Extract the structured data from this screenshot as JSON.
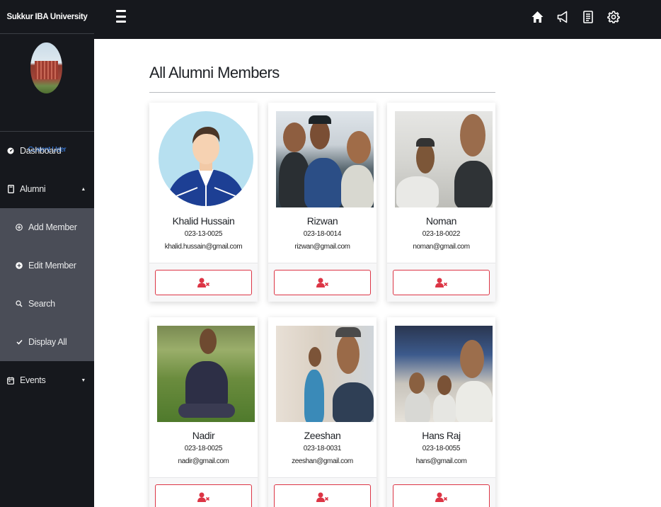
{
  "sidebar": {
    "brand": "Sukkur IBA University",
    "current_user": "Current User",
    "items": [
      {
        "label": "Dashboard",
        "icon": "dashboard-icon"
      },
      {
        "label": "Alumni",
        "icon": "alumni-icon"
      },
      {
        "label": "Add Member",
        "icon": "add-circle-icon"
      },
      {
        "label": "Edit Member",
        "icon": "edit-circle-icon"
      },
      {
        "label": "Search",
        "icon": "search-icon"
      },
      {
        "label": "Display All",
        "icon": "check-icon"
      },
      {
        "label": "Events",
        "icon": "calendar-icon"
      }
    ]
  },
  "topbar": {
    "icons": [
      "home-icon",
      "announcement-icon",
      "document-icon",
      "settings-icon"
    ]
  },
  "main": {
    "title": "All Alumni Members",
    "members": [
      {
        "name": "Khalid Hussain",
        "id": "023-13-0025",
        "email": "khalid.hussain@gmail.com"
      },
      {
        "name": "Rizwan",
        "id": "023-18-0014",
        "email": "rizwan@gmail.com"
      },
      {
        "name": "Noman",
        "id": "023-18-0022",
        "email": "noman@gmail.com"
      },
      {
        "name": "Nadir",
        "id": "023-18-0025",
        "email": "nadir@gmail.com"
      },
      {
        "name": "Zeeshan",
        "id": "023-18-0031",
        "email": "zeeshan@gmail.com"
      },
      {
        "name": "Hans Raj",
        "id": "023-18-0055",
        "email": "hans@gmail.com"
      }
    ]
  },
  "colors": {
    "sidebar_bg": "#16181d",
    "submenu_bg": "#4a4d57",
    "accent_blue": "#3d8bfd",
    "danger": "#dc3545"
  }
}
